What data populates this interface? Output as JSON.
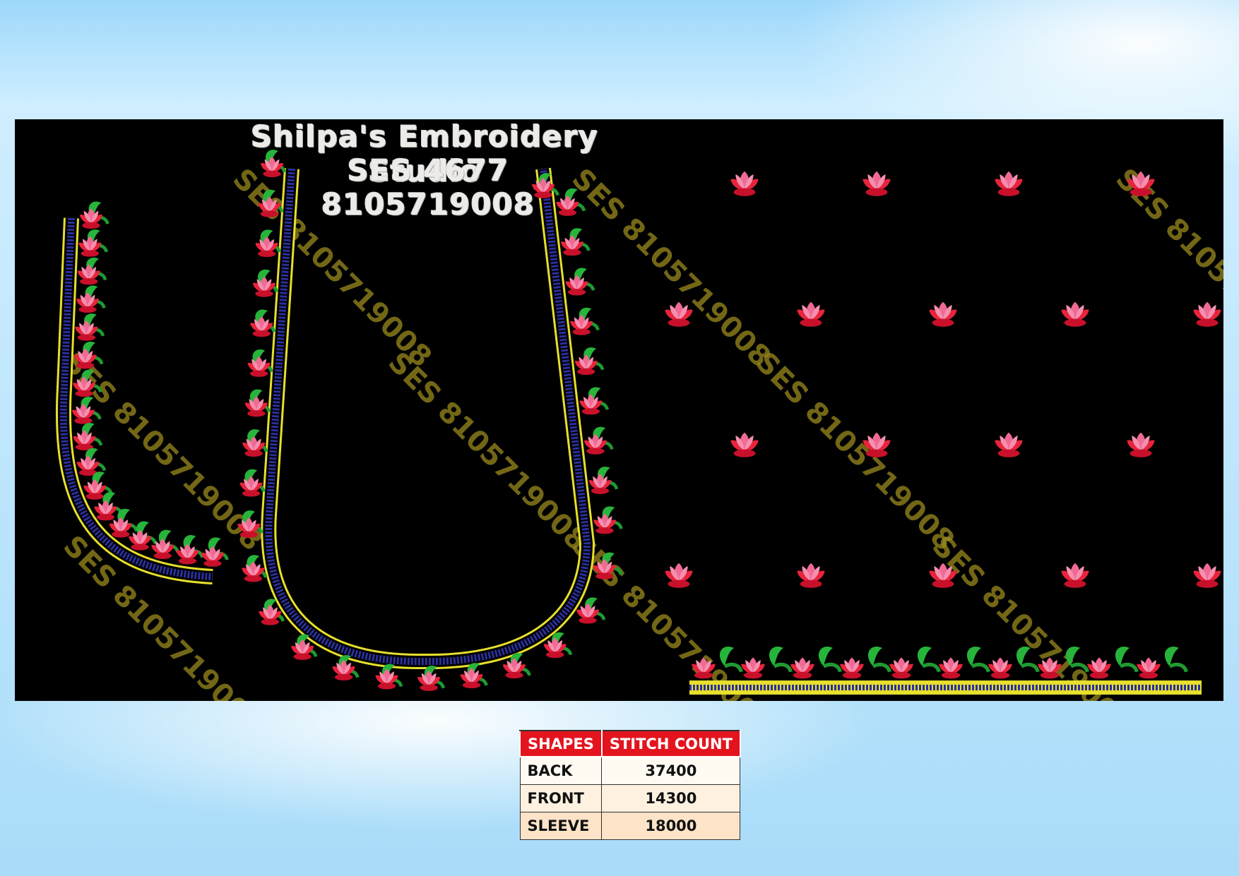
{
  "studio": {
    "name": "Shilpa's Embroidery Studio",
    "design_code": "SES 4677",
    "phone": "8105719008"
  },
  "watermark": "SES 8105719008",
  "stitch_table": {
    "headers": [
      "SHAPES",
      "STITCH COUNT"
    ],
    "rows": [
      {
        "shape": "BACK",
        "count": "37400"
      },
      {
        "shape": "FRONT",
        "count": "14300"
      },
      {
        "shape": "SLEEVE",
        "count": "18000"
      }
    ]
  },
  "colors": {
    "fabric": "#000000",
    "leaf_green": "#22b33a",
    "flower_red": "#e8243c",
    "flower_pink": "#f47aa0",
    "border_yellow": "#e6df2c",
    "border_blue": "#2b2f9a",
    "watermark_gold": "#9a8a1e",
    "table_header": "#e4141e"
  }
}
